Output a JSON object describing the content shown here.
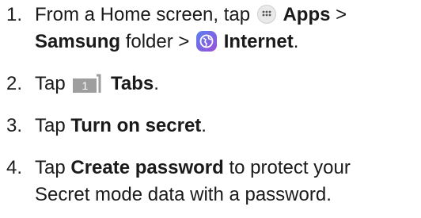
{
  "steps": [
    {
      "number": "1.",
      "line1": {
        "pre": "From a Home screen, tap",
        "apps_bold": "Apps",
        "post": ">"
      },
      "line2": {
        "folder_bold": "Samsung",
        "folder_text": "folder >",
        "internet_bold": "Internet",
        "end": "."
      }
    },
    {
      "number": "2.",
      "pre": "Tap",
      "tab_count": "1",
      "bold": "Tabs",
      "end": "."
    },
    {
      "number": "3.",
      "pre": "Tap",
      "bold": "Turn on secret",
      "end": "."
    },
    {
      "number": "4.",
      "pre": "Tap",
      "bold": "Create password",
      "post": "to protect your",
      "line2": "Secret mode data with a password."
    }
  ],
  "icons": {
    "apps": "apps-grid-icon",
    "internet": "internet-browser-icon",
    "tabs": "tabs-icon"
  },
  "colors": {
    "internet_gradient_start": "#5a7ff0",
    "internet_gradient_end": "#9b4fd8",
    "tabs_fill": "#9e9e9e"
  }
}
